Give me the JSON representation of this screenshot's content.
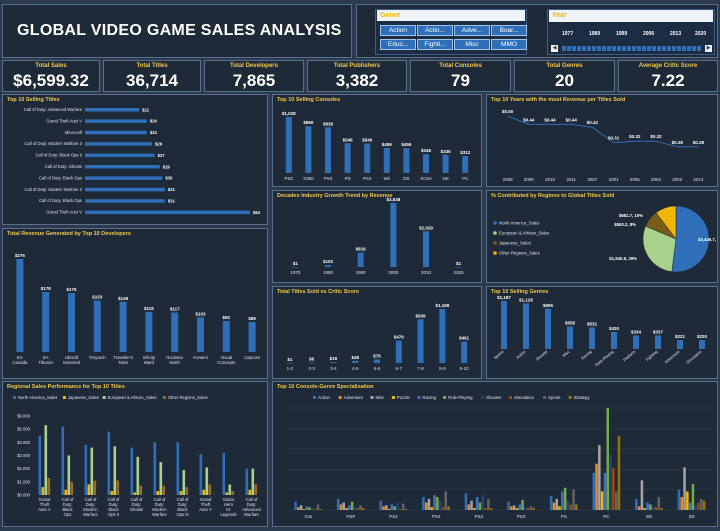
{
  "header": {
    "title": "GLOBAL VIDEO GAME SALES ANALYSIS"
  },
  "genre_slicer": {
    "title": "Genre",
    "items": [
      "Action",
      "Actio...",
      "Adve...",
      "Boar...",
      "Educ...",
      "Fighti...",
      "Misc",
      "MMO"
    ]
  },
  "timeline": {
    "title": "Year",
    "years": [
      "1977",
      "1989",
      "1999",
      "2006",
      "2013",
      "2020"
    ]
  },
  "kpis": [
    {
      "label": "Total Sales",
      "value": "$6,599.32"
    },
    {
      "label": "Total Titles",
      "value": "36,714"
    },
    {
      "label": "Total Developers",
      "value": "7,865"
    },
    {
      "label": "Total Publishers",
      "value": "3,382"
    },
    {
      "label": "Total Consoles",
      "value": "79"
    },
    {
      "label": "Total Genres",
      "value": "20"
    },
    {
      "label": "Average Critic Score",
      "value": "7.22"
    }
  ],
  "chart_data": [
    {
      "id": "top_titles",
      "type": "bar",
      "title": "Top 10 Selling Titles",
      "categories": [
        "Call of Duty: Advanced Warfare",
        "Grand Theft Auto V",
        "Minecraft",
        "Call of Duty: Modern Warfare 3",
        "Call of Duty: Black Ops II",
        "Call of Duty: Ghosts",
        "Call of Duty: Black Ops",
        "Call of Duty: Modern Warfare 2",
        "Call of Duty: Black Ops",
        "Grand Theft Auto V"
      ],
      "values": [
        21,
        24,
        24,
        26,
        27,
        29,
        30,
        31,
        31,
        64
      ],
      "labels": [
        "$21",
        "$24",
        "$24",
        "$26",
        "$27",
        "$29",
        "$30",
        "$31",
        "$31",
        "$64"
      ]
    },
    {
      "id": "top_consoles",
      "type": "bar",
      "title": "Top 10 Selling Consoles",
      "categories": [
        "PS2",
        "X360",
        "PS3",
        "PS",
        "PS4",
        "Wii",
        "DS",
        "XOne",
        "NS",
        "PC"
      ],
      "values": [
        1028,
        860,
        838,
        546,
        540,
        459,
        455,
        346,
        335,
        312
      ],
      "labels": [
        "$1,028",
        "$860",
        "$838",
        "$546",
        "$540",
        "$459",
        "$455",
        "$346",
        "$335",
        "$312"
      ]
    },
    {
      "id": "top_years",
      "type": "line",
      "title": "Top 10 Years with the most Revenue per Titles Sold",
      "x": [
        "2008",
        "2009",
        "2010",
        "2011",
        "2007",
        "2001",
        "2005",
        "2004",
        "2002",
        "2013"
      ],
      "values": [
        0.5,
        0.44,
        0.44,
        0.44,
        0.42,
        0.31,
        0.32,
        0.32,
        0.28,
        0.28
      ],
      "labels": [
        "$0.50",
        "$0.44",
        "$0.44",
        "$0.44",
        "$0.42",
        "$0.31",
        "$0.32",
        "$0.32",
        "$0.28",
        "$0.28"
      ]
    },
    {
      "id": "decades",
      "type": "bar",
      "title": "Decades Industry Growth Trend by Revenue",
      "categories": [
        "1970",
        "1980",
        "1990",
        "2000",
        "2010",
        "2020"
      ],
      "values": [
        1,
        103,
        816,
        3638,
        2029,
        1
      ],
      "labels": [
        "$1",
        "$103",
        "$816",
        "$3,638",
        "$2,029",
        "$1"
      ]
    },
    {
      "id": "regions",
      "type": "pie",
      "title": "% Contributed by Regions to Global Titles Sold",
      "series": [
        {
          "name": "North America_Sales",
          "value": 3446.7,
          "label": "$3,446.7, 51%"
        },
        {
          "name": "European & African_Sales",
          "value": 1940.8,
          "label": "$1,940.8, 29%"
        },
        {
          "name": "Japanese_Sales",
          "value": 553.2,
          "label": "$553.2, 8%"
        },
        {
          "name": "Other Regions_Sales",
          "value": 681.7,
          "label": "$681.7, 10%"
        }
      ],
      "colors": [
        "#2f6fb8",
        "#a9d18e",
        "#7a5c1a",
        "#f2b705"
      ]
    },
    {
      "id": "developers",
      "type": "bar",
      "title": "Total Revenue Generated by Top 10 Developers",
      "categories": [
        "EA Canada",
        "EA Tiburon",
        "Ubisoft Montreal",
        "Treyarch",
        "Traveller's Tales",
        "Infinity Ward",
        "Rockstar North",
        "Konami",
        "Visual Concepts",
        "Capcom"
      ],
      "values": [
        276,
        178,
        175,
        153,
        149,
        119,
        117,
        103,
        92,
        89
      ],
      "labels": [
        "$276",
        "$178",
        "$175",
        "$153",
        "$149",
        "$119",
        "$117",
        "$103",
        "$92",
        "$89"
      ]
    },
    {
      "id": "critic",
      "type": "bar",
      "title": "Total Titles Sold vs Critic Score",
      "categories": [
        "1-2",
        "2-3",
        "3-4",
        "4-5",
        "5-6",
        "6-7",
        "7-8",
        "8-9",
        "9-10"
      ],
      "values": [
        1,
        6,
        19,
        48,
        76,
        479,
        939,
        1159,
        461
      ],
      "labels": [
        "$1",
        "$6",
        "$19",
        "$48",
        "$76",
        "$479",
        "$939",
        "$1,159",
        "$461"
      ]
    },
    {
      "id": "genres",
      "type": "bar",
      "title": "Top 10 Selling Genres",
      "categories": [
        "Sports",
        "Action",
        "Shooter",
        "Misc",
        "Racing",
        "Role-Playing",
        "Platform",
        "Fighting",
        "Adventure",
        "Simulation"
      ],
      "values": [
        1187,
        1126,
        995,
        558,
        532,
        420,
        334,
        337,
        221,
        220
      ],
      "labels": [
        "$1,187",
        "$1,126",
        "$995",
        "$558",
        "$532",
        "$420",
        "$334",
        "$337",
        "$221",
        "$220"
      ]
    },
    {
      "id": "regional",
      "type": "bar",
      "title": "Regional Sales Performance for Top 10 Titles",
      "categories": [
        "Grand Theft Auto V",
        "Call of Duty: Black Ops",
        "Call of Duty: Modern Warfare 3",
        "Call of Duty: Black Ops II",
        "Call of Duty: Ghosts",
        "Call of Duty: Modern Warfare 2",
        "Call of Duty: Black Ops III",
        "Grand Theft Auto V",
        "Guitar Hero III: Legends of Rock",
        "Call of Duty: Advanced Warfare"
      ],
      "y_ticks": [
        "$0.000",
        "$1.000",
        "$2.000",
        "$3.000",
        "$4.000",
        "$5.000",
        "$6.000"
      ],
      "ylim": [
        0,
        6
      ],
      "series": [
        {
          "name": "North America_Sales",
          "color": "#2f6fb8",
          "values": [
            4.5,
            5.2,
            3.8,
            4.8,
            3.6,
            4.0,
            4.0,
            3.1,
            3.2,
            2.0
          ]
        },
        {
          "name": "Japanese_Sales",
          "color": "#f2b705",
          "values": [
            0.6,
            0.4,
            0.8,
            0.3,
            0.2,
            0.3,
            0.3,
            0.4,
            0.2,
            0.4
          ]
        },
        {
          "name": "European & African_Sales",
          "color": "#a9d18e",
          "values": [
            5.3,
            3.0,
            3.6,
            3.7,
            2.9,
            2.5,
            1.9,
            2.1,
            0.8,
            2.0
          ]
        },
        {
          "name": "Other Regions_Sales",
          "color": "#9e6a1f",
          "values": [
            1.3,
            1.0,
            1.1,
            1.1,
            0.7,
            0.7,
            0.6,
            0.8,
            0.3,
            0.8
          ]
        }
      ]
    },
    {
      "id": "console_genre",
      "type": "bar",
      "title": "Top 10 Console-Genre Specialization",
      "categories": [
        "X3s",
        "PSP",
        "PS4",
        "PS2",
        "PS3",
        "PSX",
        "PS",
        "PC",
        "Wii",
        "DS"
      ],
      "series": [
        {
          "name": "Action",
          "color": "#2f6fb8"
        },
        {
          "name": "Adventure",
          "color": "#e98b2d"
        },
        {
          "name": "Misc",
          "color": "#a5a5a5"
        },
        {
          "name": "Puzzle",
          "color": "#f2b705"
        },
        {
          "name": "Racing",
          "color": "#4472c4"
        },
        {
          "name": "Role-Playing",
          "color": "#70ad47"
        },
        {
          "name": "Shooter",
          "color": "#264478"
        },
        {
          "name": "Simulation",
          "color": "#9e480e"
        },
        {
          "name": "Sports",
          "color": "#636363"
        },
        {
          "name": "Strategy",
          "color": "#997300"
        }
      ]
    }
  ]
}
